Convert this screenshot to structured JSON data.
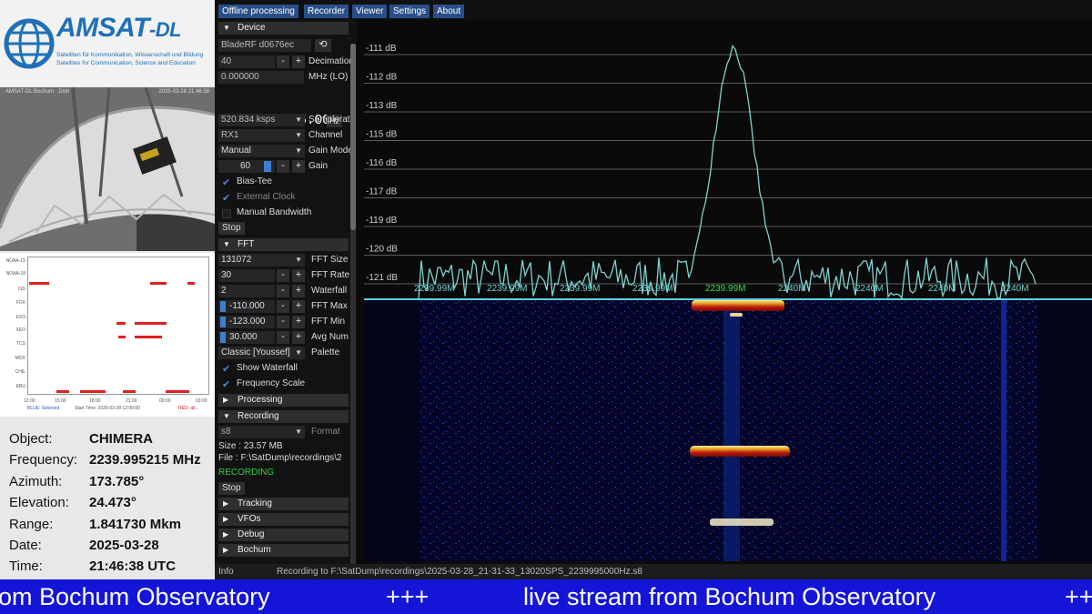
{
  "logo": {
    "name": "AMSAT",
    "suffix": "-DL",
    "tagline_de": "Satelliten für Kommunikation, Wissenschaft und Bildung",
    "tagline_en": "Satellites for Communication, Science and Education"
  },
  "camera": {
    "title": "AMSAT-DL Bochum · Dish",
    "timestamp": "2025-03-28  21:46:38"
  },
  "timeline": {
    "satellites": [
      "NOAA-15",
      "NOAA-18",
      "ISS",
      "FOX",
      "EXO",
      "XEO",
      "TCS",
      "MOX",
      "CHIL",
      "EBU"
    ],
    "ticks": [
      "12:00",
      "15:00",
      "18:00",
      "21:00",
      "00:00",
      "03:00",
      "06:00"
    ],
    "legend_blue": "BLUE: Selected",
    "start": "Start Time: 2025-03-28 12:00:00",
    "legend_red": "RED: all..."
  },
  "info": {
    "labels": {
      "object": "Object:",
      "frequency": "Frequency:",
      "azimuth": "Azimuth:",
      "elevation": "Elevation:",
      "range": "Range:",
      "date": "Date:",
      "time": "Time:"
    },
    "values": {
      "object": "CHIMERA",
      "frequency": "2239.995215 MHz",
      "azimuth": "173.785°",
      "elevation": "24.473°",
      "range": "1.841730 Mkm",
      "date": "2025-03-28",
      "time": "21:46:38 UTC"
    }
  },
  "menu": [
    "Offline processing",
    "Recorder",
    "Viewer",
    "Settings",
    "About"
  ],
  "panel": {
    "device": {
      "header": "Device",
      "device_name": "BladeRF d0676ec",
      "decimation_value": "40",
      "decimation_label": "Decimation",
      "lo_value": "0.000000",
      "lo_label": "MHz (LO)",
      "freq_lead": "00",
      "freq_main": "2.239.995.000",
      "freq_unit": "Hz",
      "samplerate_value": "520.834 ksps",
      "samplerate_label": "Samplerate",
      "channel_value": "RX1",
      "channel_label": "Channel",
      "gain_mode_value": "Manual",
      "gain_mode_label": "Gain Mode",
      "gain_value": "60",
      "gain_label": "Gain",
      "bias_tee": "Bias-Tee",
      "external_clock": "External Clock",
      "manual_bandwidth": "Manual Bandwidth",
      "stop": "Stop"
    },
    "fft": {
      "header": "FFT",
      "fft_size_value": "131072",
      "fft_size_label": "FFT Size",
      "fft_rate_value": "30",
      "fft_rate_label": "FFT Rate",
      "waterfall_value": "2",
      "waterfall_label": "Waterfall",
      "fft_max_value": "-110.000",
      "fft_max_label": "FFT Max",
      "fft_min_value": "-123.000",
      "fft_min_label": "FFT Min",
      "avg_value": "30.000",
      "avg_label": "Avg Num",
      "palette_value": "Classic [Youssef]",
      "palette_label": "Palette",
      "show_waterfall": "Show Waterfall",
      "frequency_scale": "Frequency Scale"
    },
    "processing": {
      "header": "Processing"
    },
    "recording": {
      "header": "Recording",
      "format_value": "s8",
      "format_label": "Format",
      "size": "Size : 23.57 MB",
      "file": "File : F:\\SatDump\\recordings\\2",
      "status": "RECORDING",
      "stop": "Stop"
    },
    "tracking": {
      "header": "Tracking"
    },
    "vfos": {
      "header": "VFOs"
    },
    "debug": {
      "header": "Debug"
    },
    "bochum": {
      "header": "Bochum"
    }
  },
  "fft_plot": {
    "db_labels": [
      "-111 dB",
      "-112 dB",
      "-113 dB",
      "-115 dB",
      "-116 dB",
      "-117 dB",
      "-119 dB",
      "-120 dB",
      "-121 dB"
    ],
    "freq_labels": [
      "2239.99M",
      "2239.99M",
      "2239.99M",
      "2239.99M",
      "2239.99M",
      "2240M",
      "2240M",
      "2240M",
      "2240M"
    ],
    "center_index": 4,
    "colors": {
      "trace": "#7fd3d0",
      "center_label": "#2ee04a",
      "axis_label": "#6fcfcf",
      "grid": "#808080"
    }
  },
  "status": {
    "info": "Info",
    "message": "Recording to F:\\SatDump\\recordings\\2025-03-28_21-31-33_13020SPS_2239995000Hz.s8"
  },
  "ticker": {
    "text1": "om Bochum Observatory",
    "sep1": "+++",
    "text2": "live stream from Bochum Observatory",
    "sep2": "+++"
  }
}
